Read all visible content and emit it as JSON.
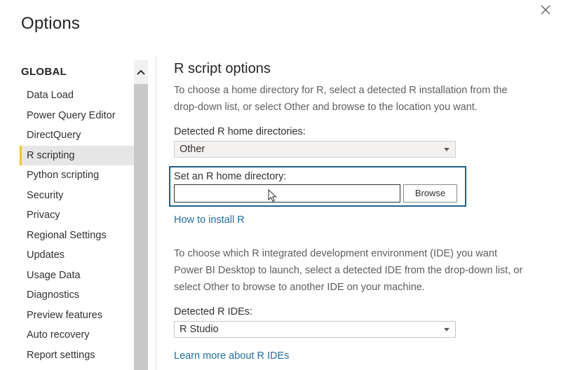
{
  "window": {
    "title": "Options",
    "close_icon": "close-icon"
  },
  "sidebar": {
    "section_header": "GLOBAL",
    "items": [
      {
        "label": "Data Load"
      },
      {
        "label": "Power Query Editor"
      },
      {
        "label": "DirectQuery"
      },
      {
        "label": "R scripting",
        "selected": true
      },
      {
        "label": "Python scripting"
      },
      {
        "label": "Security"
      },
      {
        "label": "Privacy"
      },
      {
        "label": "Regional Settings"
      },
      {
        "label": "Updates"
      },
      {
        "label": "Usage Data"
      },
      {
        "label": "Diagnostics"
      },
      {
        "label": "Preview features"
      },
      {
        "label": "Auto recovery"
      },
      {
        "label": "Report settings"
      }
    ],
    "accent_color": "#f2c811"
  },
  "main": {
    "title": "R script options",
    "intro_line1": "To choose a home directory for R, select a detected R installation from the",
    "intro_line2": "drop-down list, or select Other and browse to the location you want.",
    "home_dirs_label": "Detected R home directories:",
    "home_dirs_selected": "Other",
    "set_home_label": "Set an R home directory:",
    "set_home_value": "",
    "browse_label": "Browse",
    "install_link": "How to install R",
    "ide_line1": "To choose which R integrated development environment (IDE) you want",
    "ide_line2": "Power BI Desktop to launch, select a detected IDE from the drop-down list, or",
    "ide_line3": "select Other to browse to another IDE on your machine.",
    "ide_label": "Detected R IDEs:",
    "ide_selected": "R Studio",
    "learn_link": "Learn more about R IDEs",
    "link_color": "#1d6fa5",
    "focus_color": "#1f5f8a"
  }
}
